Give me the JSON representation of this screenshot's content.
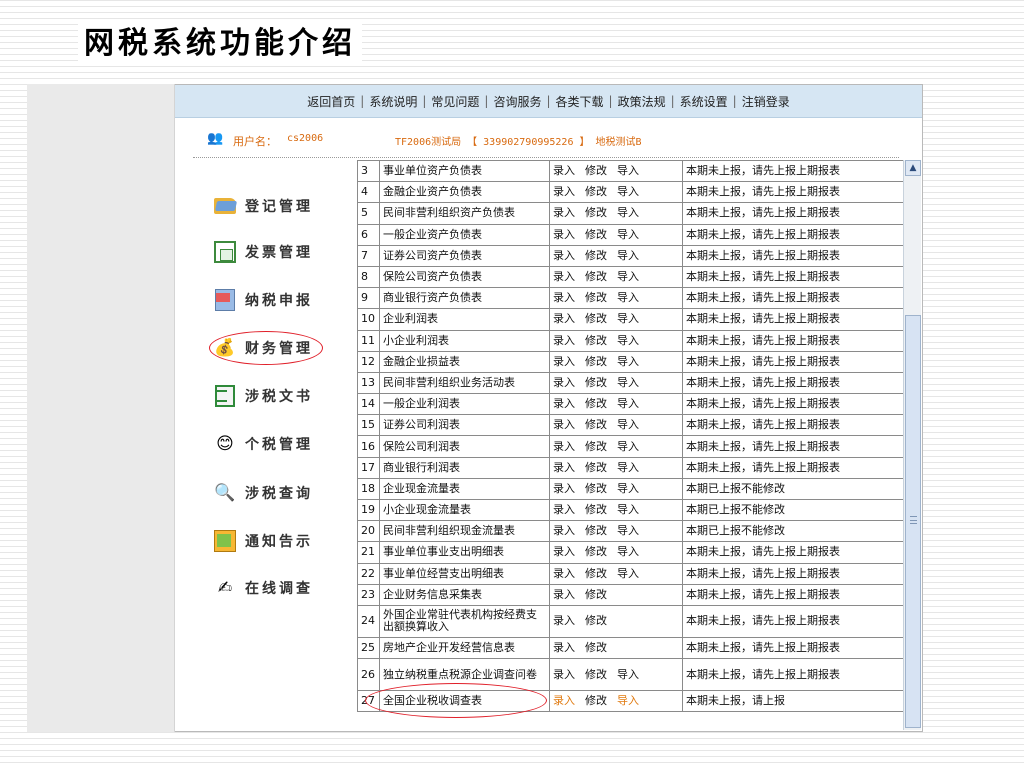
{
  "slide": {
    "title": "网税系统功能介绍"
  },
  "nav": {
    "items": [
      "返回首页",
      "系统说明",
      "常见问题",
      "咨询服务",
      "各类下载",
      "政策法规",
      "系统设置",
      "注销登录"
    ],
    "separator": "|"
  },
  "user": {
    "label": "用户名：",
    "username": "cs2006",
    "bureau": "TF2006测试局 【 339902790995226 】 地税测试B"
  },
  "sidebar": {
    "items": [
      {
        "label": "登记管理",
        "icon": "folder-icon"
      },
      {
        "label": "发票管理",
        "icon": "invoice-icon"
      },
      {
        "label": "纳税申报",
        "icon": "tax-declaration-icon"
      },
      {
        "label": "财务管理",
        "icon": "finance-icon",
        "highlighted": true
      },
      {
        "label": "涉税文书",
        "icon": "document-icon"
      },
      {
        "label": "个税管理",
        "icon": "smiley-icon"
      },
      {
        "label": "涉税查询",
        "icon": "magnifier-icon"
      },
      {
        "label": "通知告示",
        "icon": "notice-icon"
      },
      {
        "label": "在线调查",
        "icon": "survey-icon"
      }
    ]
  },
  "table": {
    "rows": [
      {
        "no": "3",
        "name": "事业单位资产负债表",
        "actions": [
          "录入",
          "修改",
          "导入"
        ],
        "status": "本期未上报，请先上报上期报表"
      },
      {
        "no": "4",
        "name": "金融企业资产负债表",
        "actions": [
          "录入",
          "修改",
          "导入"
        ],
        "status": "本期未上报，请先上报上期报表"
      },
      {
        "no": "5",
        "name": "民间非营利组织资产负债表",
        "actions": [
          "录入",
          "修改",
          "导入"
        ],
        "status": "本期未上报，请先上报上期报表"
      },
      {
        "no": "6",
        "name": "一般企业资产负债表",
        "actions": [
          "录入",
          "修改",
          "导入"
        ],
        "status": "本期未上报，请先上报上期报表"
      },
      {
        "no": "7",
        "name": "证券公司资产负债表",
        "actions": [
          "录入",
          "修改",
          "导入"
        ],
        "status": "本期未上报，请先上报上期报表"
      },
      {
        "no": "8",
        "name": "保险公司资产负债表",
        "actions": [
          "录入",
          "修改",
          "导入"
        ],
        "status": "本期未上报，请先上报上期报表"
      },
      {
        "no": "9",
        "name": "商业银行资产负债表",
        "actions": [
          "录入",
          "修改",
          "导入"
        ],
        "status": "本期未上报，请先上报上期报表"
      },
      {
        "no": "10",
        "name": "企业利润表",
        "actions": [
          "录入",
          "修改",
          "导入"
        ],
        "status": "本期未上报，请先上报上期报表"
      },
      {
        "no": "11",
        "name": "小企业利润表",
        "actions": [
          "录入",
          "修改",
          "导入"
        ],
        "status": "本期未上报，请先上报上期报表"
      },
      {
        "no": "12",
        "name": "金融企业损益表",
        "actions": [
          "录入",
          "修改",
          "导入"
        ],
        "status": "本期未上报，请先上报上期报表"
      },
      {
        "no": "13",
        "name": "民间非营利组织业务活动表",
        "actions": [
          "录入",
          "修改",
          "导入"
        ],
        "status": "本期未上报，请先上报上期报表"
      },
      {
        "no": "14",
        "name": "一般企业利润表",
        "actions": [
          "录入",
          "修改",
          "导入"
        ],
        "status": "本期未上报，请先上报上期报表"
      },
      {
        "no": "15",
        "name": "证券公司利润表",
        "actions": [
          "录入",
          "修改",
          "导入"
        ],
        "status": "本期未上报，请先上报上期报表"
      },
      {
        "no": "16",
        "name": "保险公司利润表",
        "actions": [
          "录入",
          "修改",
          "导入"
        ],
        "status": "本期未上报，请先上报上期报表"
      },
      {
        "no": "17",
        "name": "商业银行利润表",
        "actions": [
          "录入",
          "修改",
          "导入"
        ],
        "status": "本期未上报，请先上报上期报表"
      },
      {
        "no": "18",
        "name": "企业现金流量表",
        "actions": [
          "录入",
          "修改",
          "导入"
        ],
        "status": "本期已上报不能修改"
      },
      {
        "no": "19",
        "name": "小企业现金流量表",
        "actions": [
          "录入",
          "修改",
          "导入"
        ],
        "status": "本期已上报不能修改"
      },
      {
        "no": "20",
        "name": "民间非营利组织现金流量表",
        "actions": [
          "录入",
          "修改",
          "导入"
        ],
        "status": "本期已上报不能修改"
      },
      {
        "no": "21",
        "name": "事业单位事业支出明细表",
        "actions": [
          "录入",
          "修改",
          "导入"
        ],
        "status": "本期未上报，请先上报上期报表"
      },
      {
        "no": "22",
        "name": "事业单位经营支出明细表",
        "actions": [
          "录入",
          "修改",
          "导入"
        ],
        "status": "本期未上报，请先上报上期报表"
      },
      {
        "no": "23",
        "name": "企业财务信息采集表",
        "actions": [
          "录入",
          "修改"
        ],
        "status": "本期未上报，请先上报上期报表"
      },
      {
        "no": "24",
        "name": "外国企业常驻代表机构按经费支出额换算收入",
        "actions": [
          "录入",
          "修改"
        ],
        "status": "本期未上报，请先上报上期报表",
        "tall": true
      },
      {
        "no": "25",
        "name": "房地产企业开发经营信息表",
        "actions": [
          "录入",
          "修改"
        ],
        "status": "本期未上报，请先上报上期报表"
      },
      {
        "no": "26",
        "name": "独立纳税重点税源企业调查问卷",
        "actions": [
          "录入",
          "修改",
          "导入"
        ],
        "status": "本期未上报，请先上报上期报表",
        "tall": true
      },
      {
        "no": "27",
        "name": "全国企业税收调查表",
        "actions": [
          "录入",
          "修改",
          "导入"
        ],
        "status": "本期未上报，请上报",
        "highlighted": true
      }
    ]
  },
  "colors": {
    "nav_bg": "#d6e6f3",
    "accent_orange": "#d86a10",
    "highlight_circle": "#e0202a"
  }
}
